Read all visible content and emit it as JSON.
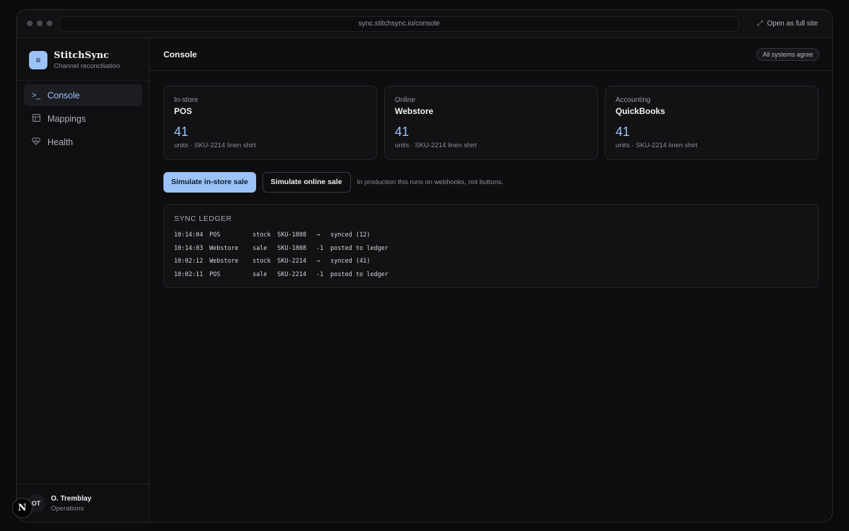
{
  "browser": {
    "url": "sync.stitchsync.io/console",
    "full_site_label": "Open as full site",
    "expand_icon": "expand-icon"
  },
  "brand": {
    "name": "StitchSync",
    "subtitle": "Channel reconciliation",
    "logo_icon": "menu-icon"
  },
  "nav": [
    {
      "label": "Console",
      "icon": "terminal-icon",
      "active": true
    },
    {
      "label": "Mappings",
      "icon": "table-icon",
      "active": false
    },
    {
      "label": "Health",
      "icon": "heart-pulse-icon",
      "active": false
    }
  ],
  "user": {
    "initials": "OT",
    "name": "O. Tremblay",
    "role": "Operations"
  },
  "header": {
    "title": "Console",
    "status": "All systems agree"
  },
  "cards": [
    {
      "kicker": "In-store",
      "title": "POS",
      "value": "41",
      "caption": "units · SKU-2214 linen shirt"
    },
    {
      "kicker": "Online",
      "title": "Webstore",
      "value": "41",
      "caption": "units · SKU-2214 linen shirt"
    },
    {
      "kicker": "Accounting",
      "title": "QuickBooks",
      "value": "41",
      "caption": "units · SKU-2214 linen shirt"
    }
  ],
  "actions": {
    "primary": "Simulate in-store sale",
    "secondary": "Simulate online sale",
    "hint": "In production this runs on webhooks, not buttons."
  },
  "ledger": {
    "title": "SYNC LEDGER",
    "rows": [
      {
        "time": "10:14:04",
        "source": "POS",
        "kind": "stock",
        "sku": "SKU-1808",
        "delta": "→",
        "result": "synced (12)"
      },
      {
        "time": "10:14:03",
        "source": "Webstore",
        "kind": "sale",
        "sku": "SKU-1808",
        "delta": "-1",
        "result": "posted to ledger"
      },
      {
        "time": "10:02:12",
        "source": "Webstore",
        "kind": "stock",
        "sku": "SKU-2214",
        "delta": "→",
        "result": "synced (41)"
      },
      {
        "time": "10:02:11",
        "source": "POS",
        "kind": "sale",
        "sku": "SKU-2214",
        "delta": "-1",
        "result": "posted to ledger"
      }
    ]
  },
  "colors": {
    "accent": "#9cc3f7",
    "background": "#0b0b0c",
    "panel": "#121215"
  }
}
